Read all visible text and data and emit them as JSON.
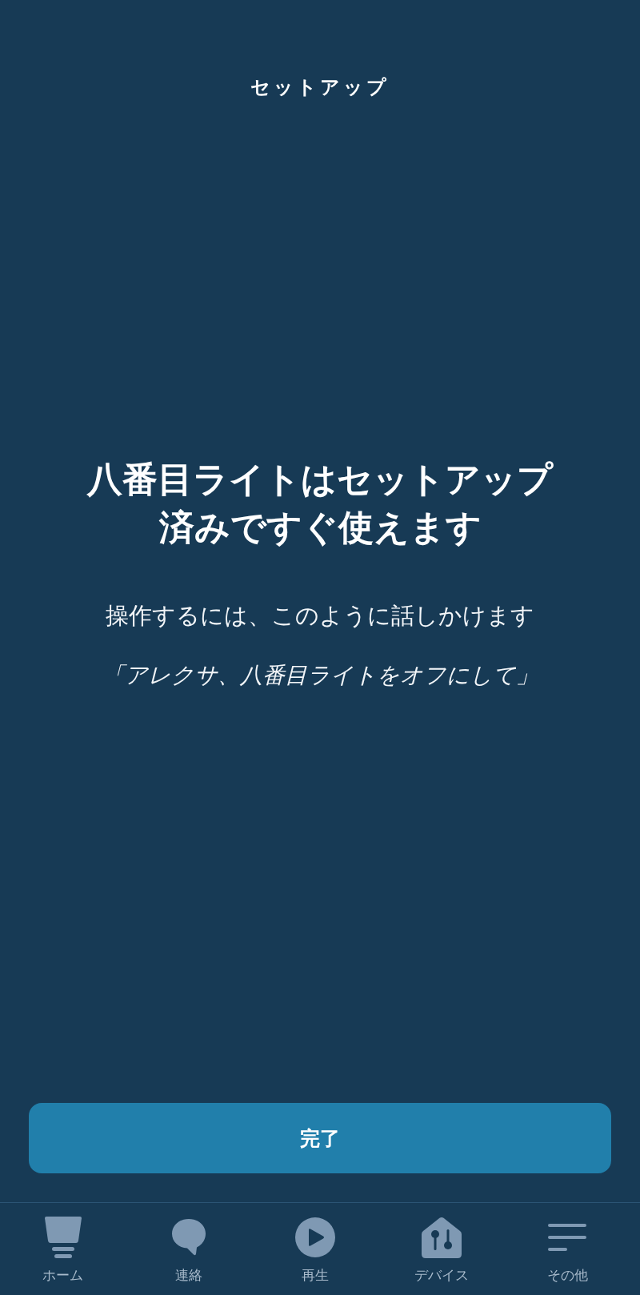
{
  "header": {
    "title": "セットアップ"
  },
  "message": {
    "heading": "八番目ライトはセットアップ済みですぐ使えます",
    "instruction": "操作するには、このように話しかけます",
    "example_phrase": "「アレクサ、八番目ライトをオフにして」"
  },
  "done_button": {
    "label": "完了"
  },
  "bottom_nav": {
    "items": [
      {
        "kind": "home",
        "label": "ホーム",
        "selected": false
      },
      {
        "kind": "contacts",
        "label": "連絡",
        "selected": false
      },
      {
        "kind": "play",
        "label": "再生",
        "selected": false
      },
      {
        "kind": "devices",
        "label": "デバイス",
        "selected": false
      },
      {
        "kind": "more",
        "label": "その他",
        "selected": false
      }
    ]
  }
}
